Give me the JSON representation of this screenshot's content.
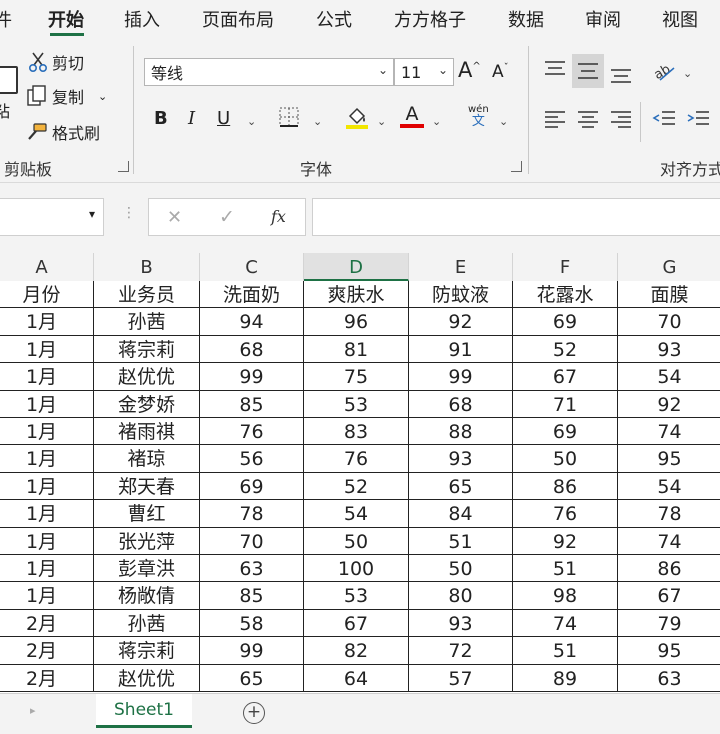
{
  "tabs": [
    "件",
    "开始",
    "插入",
    "页面布局",
    "公式",
    "方方格子",
    "数据",
    "审阅",
    "视图"
  ],
  "clipboard": {
    "cut": "剪切",
    "copy": "复制",
    "format_painter": "格式刷",
    "paste_partial": "粘",
    "group": "剪贴板"
  },
  "font": {
    "name": "等线",
    "size": "11",
    "grow": "A",
    "shrink": "A",
    "bold": "B",
    "italic": "I",
    "underline": "U",
    "color_letter": "A",
    "phonetic_top": "wén",
    "phonetic_bottom": "文",
    "group": "字体"
  },
  "alignment": {
    "group": "对齐方式"
  },
  "formula_bar": {
    "cancel": "✕",
    "enter": "✓",
    "fx": "fx",
    "name_box": "",
    "value": ""
  },
  "columns": [
    "A",
    "B",
    "C",
    "D",
    "E",
    "F",
    "G"
  ],
  "selected_column": "D",
  "headers": [
    "月份",
    "业务员",
    "洗面奶",
    "爽肤水",
    "防蚊液",
    "花露水",
    "面膜"
  ],
  "rows": [
    [
      "1月",
      "孙茜",
      "94",
      "96",
      "92",
      "69",
      "70"
    ],
    [
      "1月",
      "蒋宗莉",
      "68",
      "81",
      "91",
      "52",
      "93"
    ],
    [
      "1月",
      "赵优优",
      "99",
      "75",
      "99",
      "67",
      "54"
    ],
    [
      "1月",
      "金梦娇",
      "85",
      "53",
      "68",
      "71",
      "92"
    ],
    [
      "1月",
      "褚雨祺",
      "76",
      "83",
      "88",
      "69",
      "74"
    ],
    [
      "1月",
      "褚琼",
      "56",
      "76",
      "93",
      "50",
      "95"
    ],
    [
      "1月",
      "郑天春",
      "69",
      "52",
      "65",
      "86",
      "54"
    ],
    [
      "1月",
      "曹红",
      "78",
      "54",
      "84",
      "76",
      "78"
    ],
    [
      "1月",
      "张光萍",
      "70",
      "50",
      "51",
      "92",
      "74"
    ],
    [
      "1月",
      "彭章洪",
      "63",
      "100",
      "50",
      "51",
      "86"
    ],
    [
      "1月",
      "杨敞倩",
      "85",
      "53",
      "80",
      "98",
      "67"
    ],
    [
      "2月",
      "孙茜",
      "58",
      "67",
      "93",
      "74",
      "79"
    ],
    [
      "2月",
      "蒋宗莉",
      "99",
      "82",
      "72",
      "51",
      "95"
    ],
    [
      "2月",
      "赵优优",
      "65",
      "64",
      "57",
      "89",
      "63"
    ]
  ],
  "sheet": {
    "tab": "Sheet1",
    "add": "+"
  },
  "colors": {
    "accent": "#1e7145",
    "highlight": "#f2e600",
    "font_red": "#e00000"
  }
}
